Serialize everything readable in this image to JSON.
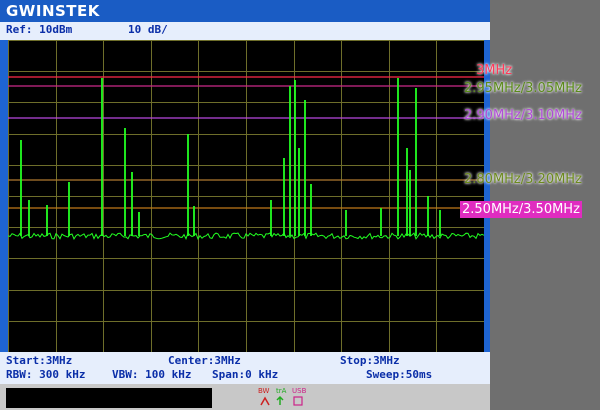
{
  "brand": "GWINSTEK",
  "header": {
    "ref": "Ref: 10dBm",
    "scale": "10 dB/"
  },
  "footer": {
    "start": "Start:3MHz",
    "center": "Center:3MHz",
    "stop": "Stop:3MHz",
    "rbw": "RBW: 300 kHz",
    "vbw": "VBW: 100 kHz",
    "span": "Span:0 kHz",
    "sweep": "Sweep:50ms"
  },
  "status_icons": [
    "BW",
    "trA",
    "USB"
  ],
  "markers": [
    {
      "label": "3MHz",
      "color": "#ff2a4a",
      "style": "red"
    },
    {
      "label": "2.95MHz/3.05MHz",
      "color": "#cc2a8a",
      "style": "green"
    },
    {
      "label": "2.90MHz/3.10MHz",
      "color": "#b848e0",
      "style": "violet"
    },
    {
      "label": "2.80MHz/3.20MHz",
      "color": "#b07a30",
      "style": "olive"
    },
    {
      "label": "2.50MHz/3.50MHz",
      "color": "#c07818",
      "style": "magenta"
    }
  ],
  "colors": {
    "trace": "#22ff22",
    "grid": "#6e6e2a",
    "screen_bg": "#000000",
    "frame": "#1e64d2"
  }
}
